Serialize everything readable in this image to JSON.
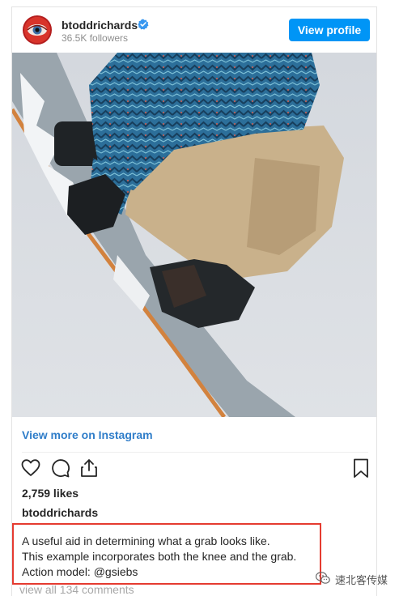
{
  "post": {
    "username": "btoddrichards",
    "followers": "36.5K followers",
    "view_profile_label": "View profile",
    "view_more_label": "View more on Instagram",
    "likes": "2,759 likes",
    "caption_username": "btoddrichards",
    "caption_lines": [
      "A useful aid in determining what a grab looks like.",
      "This example incorporates both the knee and the grab.",
      "Action model: @gsiebs"
    ],
    "view_all_comments": "view all 134 comments"
  },
  "icons": {
    "verified": "verified-badge-icon",
    "like": "heart-icon",
    "comment": "comment-bubble-icon",
    "share": "share-icon",
    "save": "bookmark-icon",
    "watermark": "wechat-icon"
  },
  "watermark": {
    "text": "速北客传媒"
  },
  "colors": {
    "primary_button": "#0095f6",
    "link": "#2f7dc9",
    "highlight_border": "#e53b30",
    "muted_text": "#8e8e8e"
  }
}
